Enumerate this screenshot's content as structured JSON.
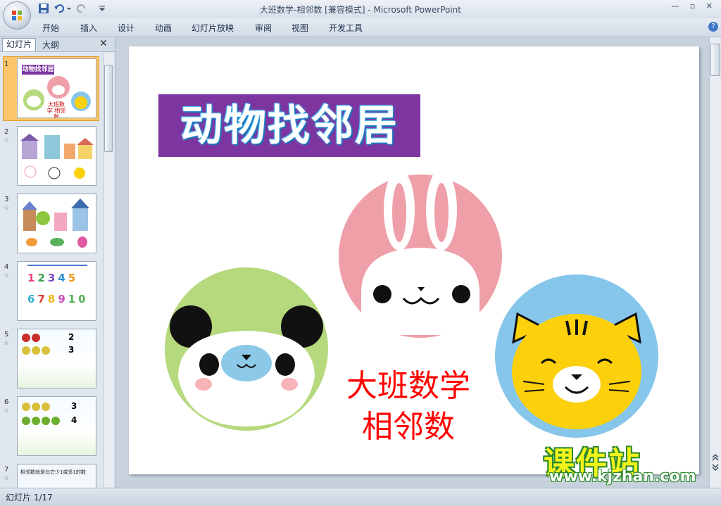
{
  "window": {
    "title": "大班数学-相邻数 [兼容模式] - Microsoft PowerPoint",
    "controls": "— ▫ ✕"
  },
  "ribbon": {
    "tabs": [
      "开始",
      "插入",
      "设计",
      "动画",
      "幻灯片放映",
      "审阅",
      "视图",
      "开发工具"
    ],
    "help": "?"
  },
  "pane": {
    "tab_slides": "幻灯片",
    "tab_outline": "大纲",
    "close": "✕",
    "slide_numbers": [
      "1",
      "2",
      "3",
      "4",
      "5",
      "6",
      "7"
    ],
    "star": "☆"
  },
  "thumbs": {
    "t1_title": "动物找邻居",
    "t1_sub": "大班数学 相邻数",
    "t4_numbers": [
      "1",
      "2",
      "3",
      "4",
      "5",
      "6",
      "7",
      "8",
      "9",
      "10"
    ],
    "t5_nums": [
      "2",
      "3"
    ],
    "t6_nums": [
      "3",
      "4"
    ],
    "t7_text": "相邻数就是比它少1或多1的数"
  },
  "slide": {
    "title": "动物找邻居",
    "subtitle_line1": "大班数学",
    "subtitle_line2": "相邻数",
    "watermark": "课件站",
    "watermark_url": "www.kjzhan.com"
  },
  "status": {
    "text": "幻灯片 1/17"
  },
  "colors": {
    "title_bg": "#7d35a0",
    "subtitle": "#ff0000",
    "panda_circle": "#b5d97c",
    "bunny_circle": "#ee9fa8",
    "tiger_circle": "#86c6ea",
    "tiger_face": "#fcd00a",
    "selected_thumb": "#fbc66b"
  }
}
